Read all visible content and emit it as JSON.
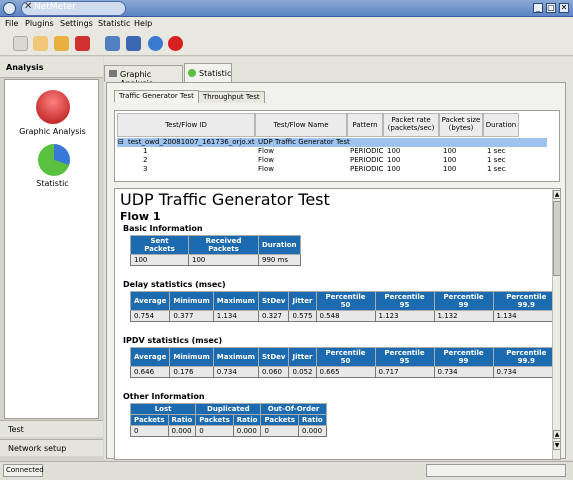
{
  "window": {
    "title": "NetMeter",
    "app_glyph": "✕"
  },
  "menu": [
    "File",
    "Plugins",
    "Settings",
    "Statistic",
    "Help"
  ],
  "left": {
    "header": "Analysis",
    "items": [
      {
        "label": "Graphic Analysis",
        "icon": "graphic-analysis-icon"
      },
      {
        "label": "Statistic",
        "icon": "statistic-icon"
      }
    ],
    "footer": [
      "Test",
      "Network setup"
    ]
  },
  "tabs": [
    "Graphic Analysis",
    "Statistic"
  ],
  "inner_tabs": [
    "Traffic Generator Test",
    "Throughput Test"
  ],
  "table": {
    "columns": [
      "Test/Flow ID",
      "Test/Flow Name",
      "Pattern",
      "Packet rate (packets/sec)",
      "Packet size (bytes)",
      "Duration"
    ],
    "rows": [
      {
        "id": "test_owd_20081007_161736_orjo.xt",
        "name": "UDP Traffic Generator Test",
        "pattern": "",
        "rate": "",
        "size": "",
        "dur": ""
      },
      {
        "id": "1",
        "name": "Flow",
        "pattern": "PERIODIC",
        "rate": "100",
        "size": "100",
        "dur": "1 sec"
      },
      {
        "id": "2",
        "name": "Flow",
        "pattern": "PERIODIC",
        "rate": "100",
        "size": "100",
        "dur": "1 sec"
      },
      {
        "id": "3",
        "name": "Flow",
        "pattern": "PERIODIC",
        "rate": "100",
        "size": "100",
        "dur": "1 sec"
      }
    ]
  },
  "report": {
    "title": "UDP Traffic Generator Test",
    "flow": "Flow 1",
    "basic": {
      "heading": "Basic Information",
      "cols": [
        "Sent Packets",
        "Received Packets",
        "Duration"
      ],
      "vals": [
        "100",
        "100",
        "990 ms"
      ]
    },
    "delay": {
      "heading": "Delay statistics (msec)",
      "cols": [
        "Average",
        "Minimum",
        "Maximum",
        "StDev",
        "Jitter",
        "Percentile 50",
        "Percentile 95",
        "Percentile 99",
        "Percentile 99.9"
      ],
      "vals": [
        "0.754",
        "0.377",
        "1.134",
        "0.327",
        "0.575",
        "0.548",
        "1.123",
        "1.132",
        "1.134"
      ]
    },
    "ipdv": {
      "heading": "IPDV statistics (msec)",
      "cols": [
        "Average",
        "Minimum",
        "Maximum",
        "StDev",
        "Jitter",
        "Percentile 50",
        "Percentile 95",
        "Percentile 99",
        "Percentile 99.9"
      ],
      "vals": [
        "0.646",
        "0.176",
        "0.734",
        "0.060",
        "0.052",
        "0.665",
        "0.717",
        "0.734",
        "0.734"
      ]
    },
    "other": {
      "heading": "Other Information",
      "groups": [
        "Lost",
        "Duplicated",
        "Out-Of-Order"
      ],
      "cols": [
        "Packets",
        "Ratio",
        "Packets",
        "Ratio",
        "Packets",
        "Ratio"
      ],
      "vals": [
        "0",
        "0.000",
        "0",
        "0.000",
        "0",
        "0.000"
      ]
    }
  },
  "status": "Connected"
}
